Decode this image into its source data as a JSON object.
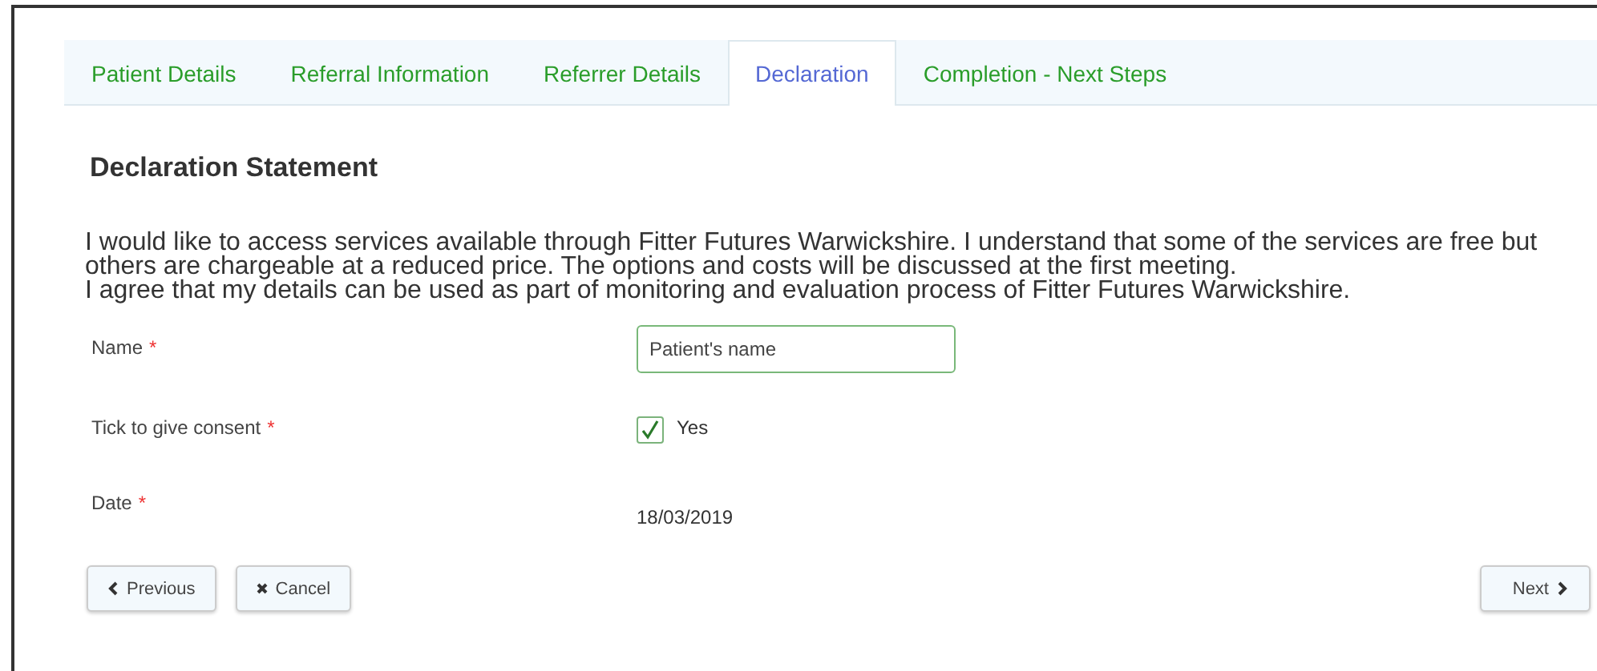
{
  "tabs": [
    {
      "label": "Patient Details",
      "selected": false
    },
    {
      "label": "Referral Information",
      "selected": false
    },
    {
      "label": "Referrer Details",
      "selected": false
    },
    {
      "label": "Declaration",
      "selected": true
    },
    {
      "label": "Completion - Next Steps",
      "selected": false
    }
  ],
  "heading": "Declaration Statement",
  "statement": [
    "I would like to access services available through Fitter Futures Warwickshire. I understand that some of the services are free but others are chargeable at a reduced price. The options and costs will be discussed at the first meeting.",
    "I agree that my details can be used as part of monitoring and evaluation process of Fitter Futures Warwickshire."
  ],
  "fields": [
    {
      "kind": "text",
      "label": "Name",
      "required": "*",
      "value": "Patient's name"
    },
    {
      "kind": "checkbox",
      "label": "Tick to give consent",
      "required": "*",
      "checked": true,
      "option": "Yes"
    },
    {
      "kind": "static",
      "label": "Date",
      "required": "*",
      "value": "18/03/2019"
    }
  ],
  "buttons": {
    "previous": "Previous",
    "cancel": "Cancel",
    "next": "Next"
  }
}
